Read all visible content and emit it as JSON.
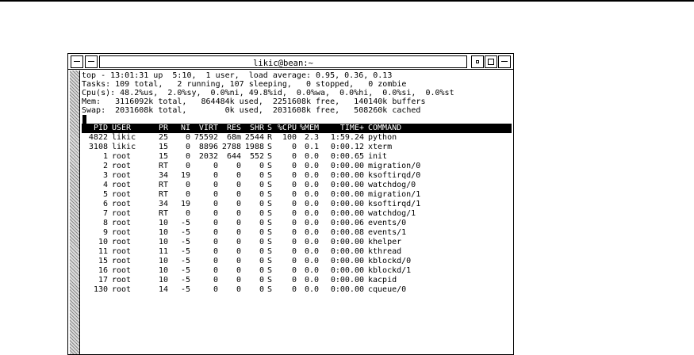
{
  "window": {
    "title": "likic@bean:~"
  },
  "summary": [
    "top - 13:01:31 up  5:10,  1 user,  load average: 0.95, 0.36, 0.13",
    "Tasks: 109 total,   2 running, 107 sleeping,   0 stopped,   0 zombie",
    "Cpu(s): 48.2%us,  2.0%sy,  0.0%ni, 49.8%id,  0.0%wa,  0.0%hi,  0.0%si,  0.0%st",
    "Mem:   3116092k total,   864484k used,  2251608k free,   140140k buffers",
    "Swap:  2031608k total,        0k used,  2031608k free,   508260k cached"
  ],
  "columns": {
    "pid": "PID",
    "user": "USER",
    "pr": "PR",
    "ni": "NI",
    "virt": "VIRT",
    "res": "RES",
    "shr": "SHR",
    "s": "S",
    "cpu": "%CPU",
    "mem": "%MEM",
    "time": "TIME+",
    "command": "COMMAND"
  },
  "processes": [
    {
      "pid": "4822",
      "user": "likic",
      "pr": "25",
      "ni": "0",
      "virt": "75592",
      "res": "68m",
      "shr": "2544",
      "s": "R",
      "cpu": "100",
      "mem": "2.3",
      "time": "1:59.24",
      "command": "python"
    },
    {
      "pid": "3108",
      "user": "likic",
      "pr": "15",
      "ni": "0",
      "virt": "8896",
      "res": "2788",
      "shr": "1988",
      "s": "S",
      "cpu": "0",
      "mem": "0.1",
      "time": "0:00.12",
      "command": "xterm"
    },
    {
      "pid": "1",
      "user": "root",
      "pr": "15",
      "ni": "0",
      "virt": "2032",
      "res": "644",
      "shr": "552",
      "s": "S",
      "cpu": "0",
      "mem": "0.0",
      "time": "0:00.65",
      "command": "init"
    },
    {
      "pid": "2",
      "user": "root",
      "pr": "RT",
      "ni": "0",
      "virt": "0",
      "res": "0",
      "shr": "0",
      "s": "S",
      "cpu": "0",
      "mem": "0.0",
      "time": "0:00.00",
      "command": "migration/0"
    },
    {
      "pid": "3",
      "user": "root",
      "pr": "34",
      "ni": "19",
      "virt": "0",
      "res": "0",
      "shr": "0",
      "s": "S",
      "cpu": "0",
      "mem": "0.0",
      "time": "0:00.00",
      "command": "ksoftirqd/0"
    },
    {
      "pid": "4",
      "user": "root",
      "pr": "RT",
      "ni": "0",
      "virt": "0",
      "res": "0",
      "shr": "0",
      "s": "S",
      "cpu": "0",
      "mem": "0.0",
      "time": "0:00.00",
      "command": "watchdog/0"
    },
    {
      "pid": "5",
      "user": "root",
      "pr": "RT",
      "ni": "0",
      "virt": "0",
      "res": "0",
      "shr": "0",
      "s": "S",
      "cpu": "0",
      "mem": "0.0",
      "time": "0:00.00",
      "command": "migration/1"
    },
    {
      "pid": "6",
      "user": "root",
      "pr": "34",
      "ni": "19",
      "virt": "0",
      "res": "0",
      "shr": "0",
      "s": "S",
      "cpu": "0",
      "mem": "0.0",
      "time": "0:00.00",
      "command": "ksoftirqd/1"
    },
    {
      "pid": "7",
      "user": "root",
      "pr": "RT",
      "ni": "0",
      "virt": "0",
      "res": "0",
      "shr": "0",
      "s": "S",
      "cpu": "0",
      "mem": "0.0",
      "time": "0:00.00",
      "command": "watchdog/1"
    },
    {
      "pid": "8",
      "user": "root",
      "pr": "10",
      "ni": "-5",
      "virt": "0",
      "res": "0",
      "shr": "0",
      "s": "S",
      "cpu": "0",
      "mem": "0.0",
      "time": "0:00.06",
      "command": "events/0"
    },
    {
      "pid": "9",
      "user": "root",
      "pr": "10",
      "ni": "-5",
      "virt": "0",
      "res": "0",
      "shr": "0",
      "s": "S",
      "cpu": "0",
      "mem": "0.0",
      "time": "0:00.08",
      "command": "events/1"
    },
    {
      "pid": "10",
      "user": "root",
      "pr": "10",
      "ni": "-5",
      "virt": "0",
      "res": "0",
      "shr": "0",
      "s": "S",
      "cpu": "0",
      "mem": "0.0",
      "time": "0:00.00",
      "command": "khelper"
    },
    {
      "pid": "11",
      "user": "root",
      "pr": "11",
      "ni": "-5",
      "virt": "0",
      "res": "0",
      "shr": "0",
      "s": "S",
      "cpu": "0",
      "mem": "0.0",
      "time": "0:00.00",
      "command": "kthread"
    },
    {
      "pid": "15",
      "user": "root",
      "pr": "10",
      "ni": "-5",
      "virt": "0",
      "res": "0",
      "shr": "0",
      "s": "S",
      "cpu": "0",
      "mem": "0.0",
      "time": "0:00.00",
      "command": "kblockd/0"
    },
    {
      "pid": "16",
      "user": "root",
      "pr": "10",
      "ni": "-5",
      "virt": "0",
      "res": "0",
      "shr": "0",
      "s": "S",
      "cpu": "0",
      "mem": "0.0",
      "time": "0:00.00",
      "command": "kblockd/1"
    },
    {
      "pid": "17",
      "user": "root",
      "pr": "10",
      "ni": "-5",
      "virt": "0",
      "res": "0",
      "shr": "0",
      "s": "S",
      "cpu": "0",
      "mem": "0.0",
      "time": "0:00.00",
      "command": "kacpid"
    },
    {
      "pid": "130",
      "user": "root",
      "pr": "14",
      "ni": "-5",
      "virt": "0",
      "res": "0",
      "shr": "0",
      "s": "S",
      "cpu": "0",
      "mem": "0.0",
      "time": "0:00.00",
      "command": "cqueue/0"
    }
  ]
}
